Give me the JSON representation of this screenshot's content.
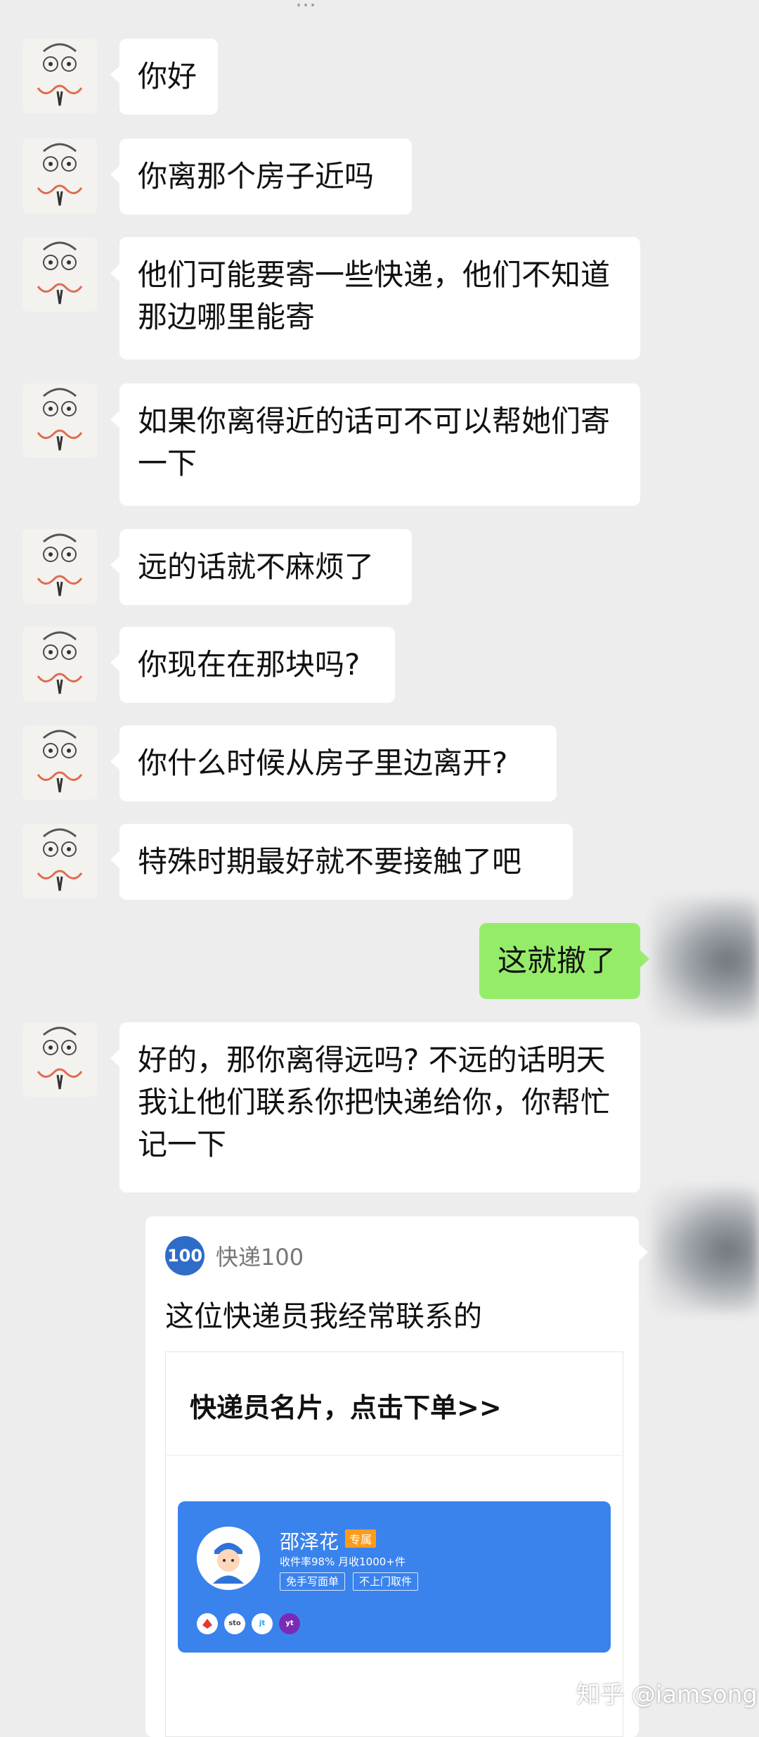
{
  "top_fragment": "…",
  "messages": [
    {
      "text": "你好"
    },
    {
      "text": "你离那个房子近吗"
    },
    {
      "text": "他们可能要寄一些快递，他们不知道那边哪里能寄"
    },
    {
      "text": "如果你离得近的话可不可以帮她们寄一下"
    },
    {
      "text": "远的话就不麻烦了"
    },
    {
      "text": "你现在在那块吗?"
    },
    {
      "text": "你什么时候从房子里边离开?"
    },
    {
      "text": "特殊时期最好就不要接触了吧"
    },
    {
      "text": "这就撤了"
    },
    {
      "text": "好的，那你离得远吗? 不远的话明天我让他们联系你把快递给你，你帮忙记一下"
    }
  ],
  "mini_program": {
    "app_name": "快递100",
    "logo_text": "100",
    "title": "这位快递员我经常联系的",
    "card_title": "快递员名片，点击下单>>",
    "courier": {
      "name": "邵泽花",
      "tag": "专属",
      "stats": "收件率98% 月收1000+件",
      "buttons": [
        "免手写面单",
        "不上门取件"
      ],
      "carriers": [
        "sto",
        "jt",
        "yt"
      ]
    }
  },
  "watermark": "知乎 @iamsong",
  "colors": {
    "background": "#ededed",
    "my_bubble": "#95ec69",
    "card_blue": "#3a83ed"
  },
  "icons": [
    "avatar-icon",
    "courier-avatar-icon",
    "logistics-logo-icon"
  ]
}
